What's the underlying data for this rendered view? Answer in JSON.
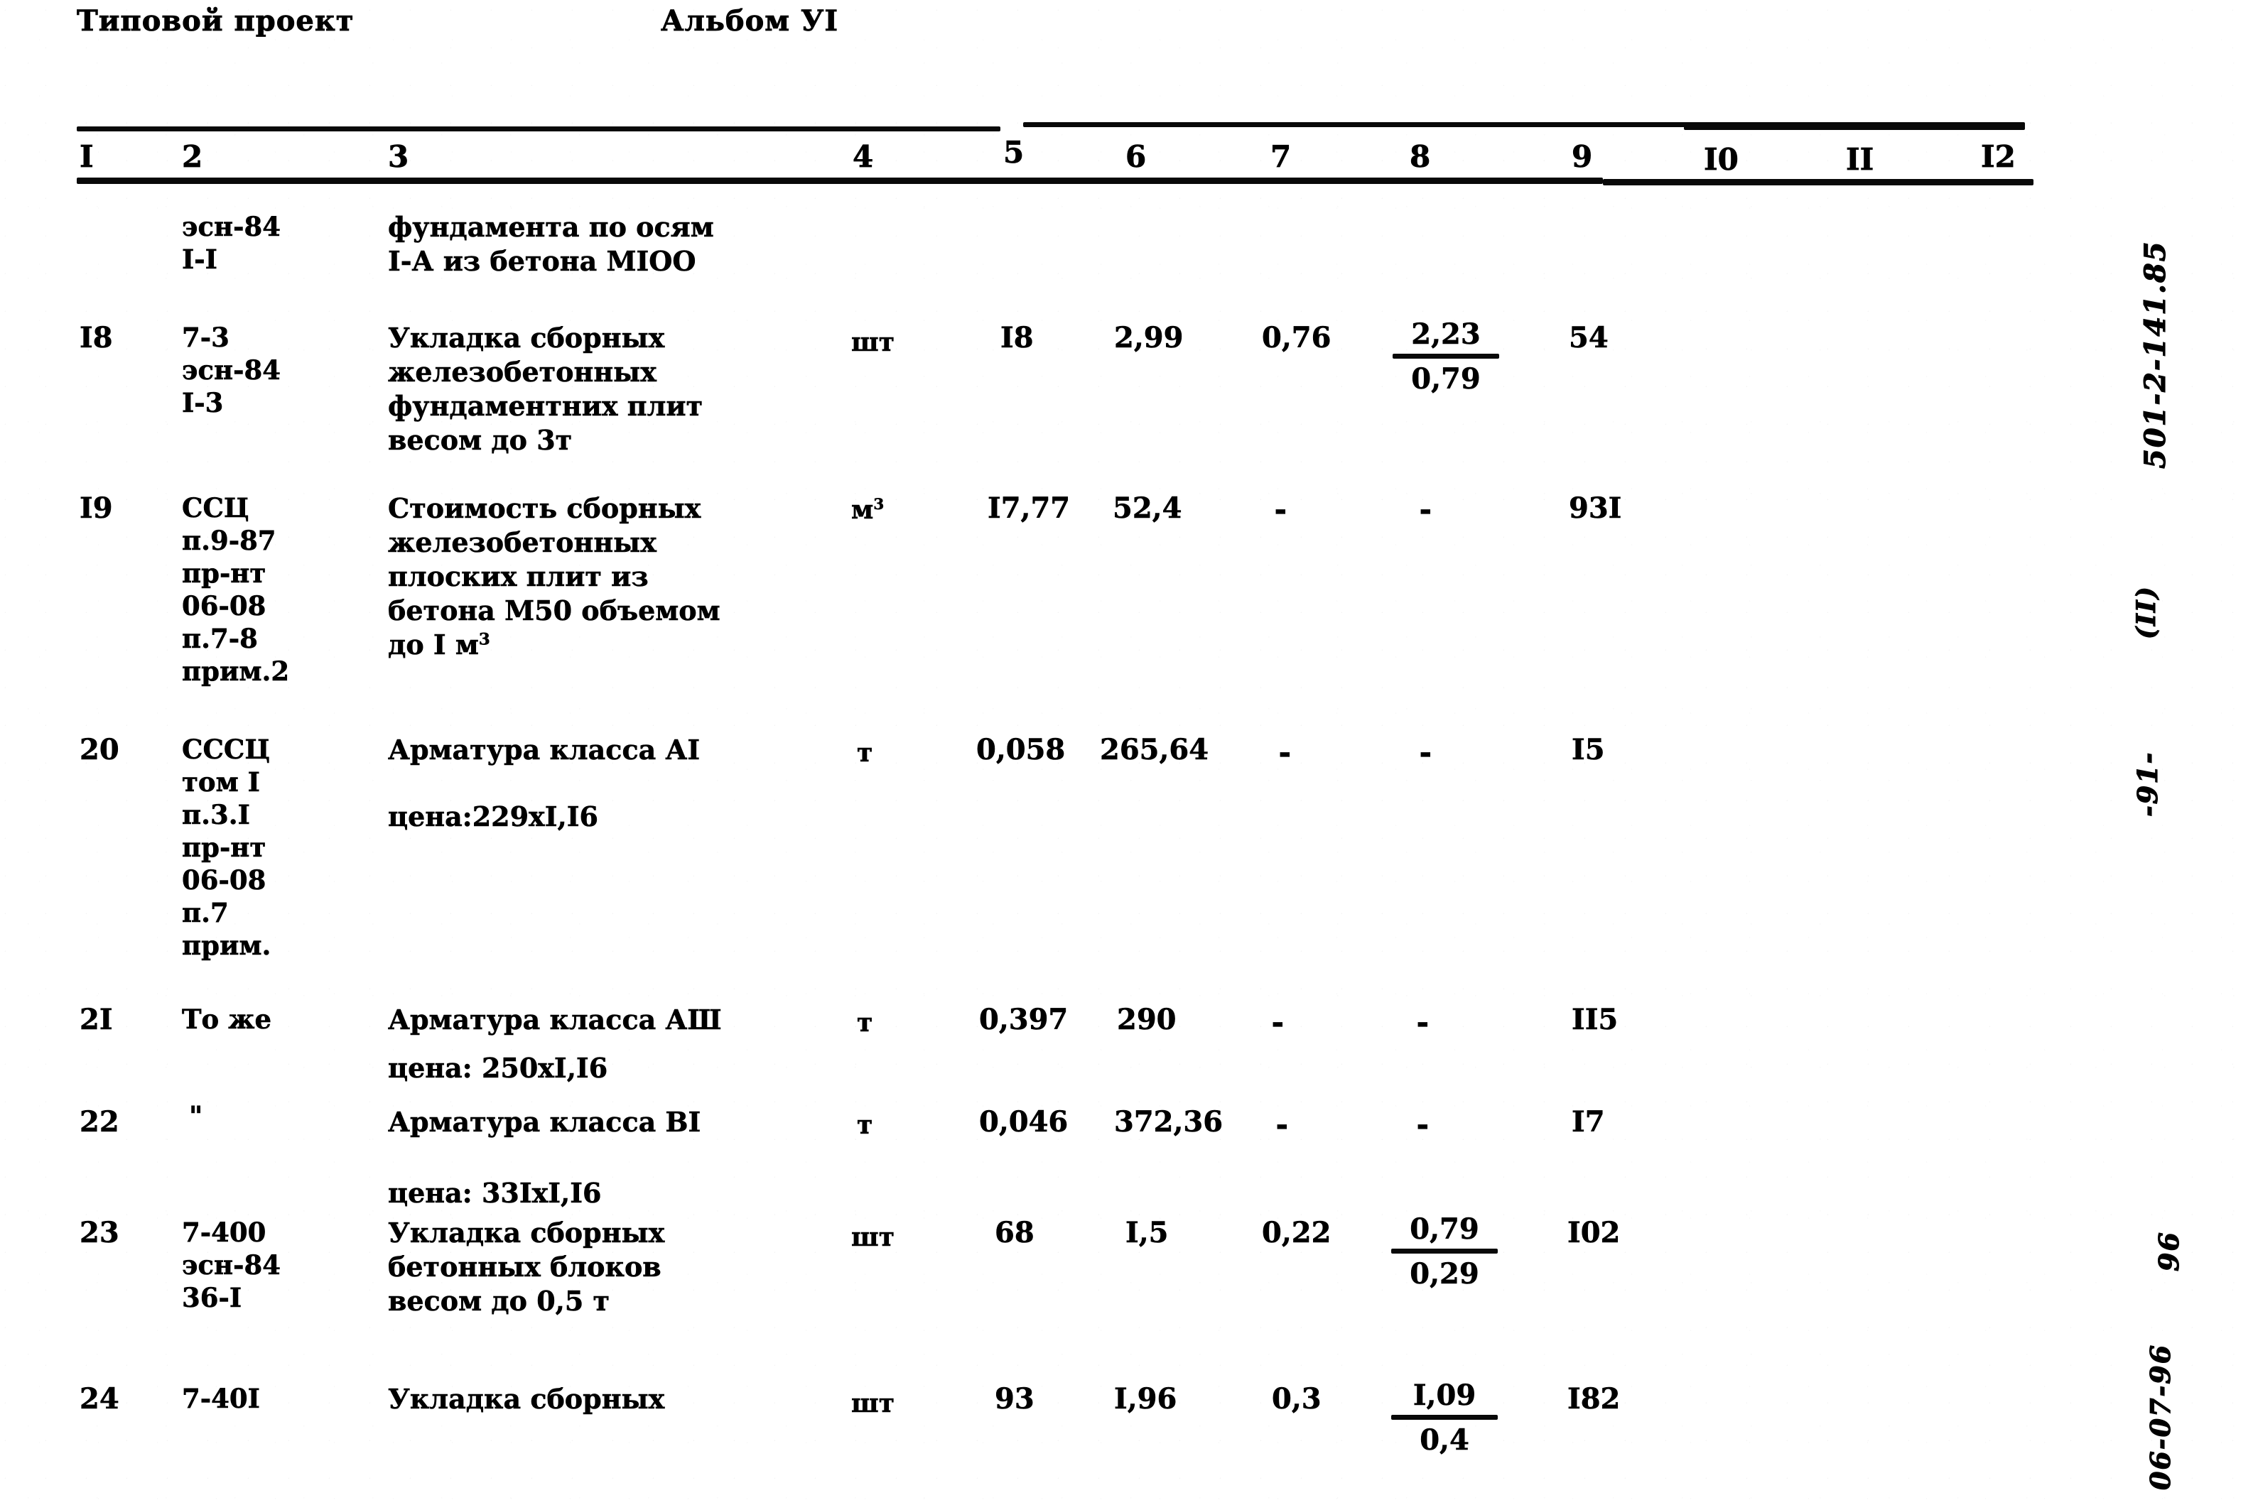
{
  "document": {
    "header_left": "Типовой проект",
    "header_right": "Альбом УI"
  },
  "table": {
    "column_headers": [
      "I",
      "2",
      "3",
      "4",
      "5",
      "6",
      "7",
      "8",
      "9",
      "I0",
      "II",
      "I2"
    ],
    "rows": [
      {
        "num": "",
        "code": "эсн-84\nI-I",
        "desc": "фундамента по осям\nI-А из бетона МIОО",
        "unit": "",
        "c5": "",
        "c6": "",
        "c7": "",
        "c8_top": "",
        "c8_bottom": "",
        "c9": ""
      },
      {
        "num": "I8",
        "code": "7-3\nэсн-84\nI-3",
        "desc": "Укладка сборных\nжелезобетонных\nфундаментних плит\nвесом до 3т",
        "unit": "шт",
        "c5": "I8",
        "c6": "2,99",
        "c7": "0,76",
        "c8_top": "2,23",
        "c8_bottom": "0,79",
        "c9": "54"
      },
      {
        "num": "I9",
        "code": "ССЦ\nп.9-87\nпр-нт\n06-08\nп.7-8\nприм.2",
        "desc": "Стоимость сборных\nжелезобетонных\nплоских плит из\nбетона М50 объемом\nдо I м",
        "desc_sup": "3",
        "unit": "м",
        "unit_sup": "3",
        "c5": "I7,77",
        "c6": "52,4",
        "c7": "-",
        "c8_top": "-",
        "c8_bottom": "",
        "c9": "93I"
      },
      {
        "num": "20",
        "code": "СССЦ\nтом I\nп.3.I\nпр-нт\n06-08\nп.7\nприм.",
        "desc": "Арматура класса АI",
        "desc2": "цена:229хI,I6",
        "unit": "т",
        "c5": "0,058",
        "c6": "265,64",
        "c7": "-",
        "c8_top": "-",
        "c8_bottom": "",
        "c9": "I5"
      },
      {
        "num": "2I",
        "code": "То же",
        "desc": "Арматура класса АШ",
        "desc2": "цена: 250хI,I6",
        "unit": "т",
        "c5": "0,397",
        "c6": "290",
        "c7": "-",
        "c8_top": "-",
        "c8_bottom": "",
        "c9": "II5"
      },
      {
        "num": "22",
        "code": "\"",
        "desc": "Арматура класса ВI",
        "desc2": "цена: 33IхI,I6",
        "unit": "т",
        "c5": "0,046",
        "c6": "372,36",
        "c7": "-",
        "c8_top": "-",
        "c8_bottom": "",
        "c9": "I7"
      },
      {
        "num": "23",
        "code": "7-400\nэсн-84\n36-I",
        "desc": "Укладка сборных\nбетонных блоков\nвесом до 0,5 т",
        "unit": "шт",
        "c5": "68",
        "c6": "I,5",
        "c7": "0,22",
        "c8_top": "0,79",
        "c8_bottom": "0,29",
        "c9": "I02"
      },
      {
        "num": "24",
        "code": "7-40I",
        "desc": "Укладка сборных",
        "unit": "шт",
        "c5": "93",
        "c6": "I,96",
        "c7": "0,3",
        "c8_top": "I,09",
        "c8_bottom": "0,4",
        "c9": "I82"
      }
    ]
  },
  "margin_notes": {
    "project_code": "501-2-141.85",
    "volume": "(II)",
    "page_number": "-91-",
    "stamp_number": "96",
    "stamp_date": "06-07-96"
  }
}
